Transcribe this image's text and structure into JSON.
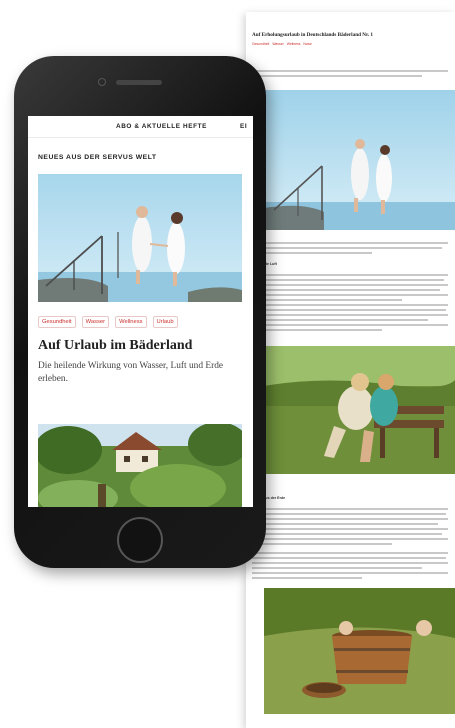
{
  "article": {
    "title": "Auf Erholungsurlaub in Deutschlands Bäderland Nr. 1",
    "tags": [
      "Gesundheit",
      "Wasser",
      "Wellness",
      "Natur"
    ],
    "subheads": [
      "Heilende Luft",
      "Kraft aus der Erde"
    ]
  },
  "phone": {
    "nav": {
      "item1": "ABO & AKTUELLE HEFTE",
      "item2": "EI"
    },
    "section_label": "NEUES AUS DER SERVUS WELT",
    "tags": [
      "Gesundheit",
      "Wasser",
      "Wellness",
      "Urlaub"
    ],
    "headline": "Auf Urlaub im Bäderland",
    "teaser": "Die heilende Wirkung von Wasser, Luft und Erde erleben."
  },
  "colors": {
    "accent": "#c9302c",
    "text": "#222222",
    "phone_body": "#1a1a1a"
  }
}
